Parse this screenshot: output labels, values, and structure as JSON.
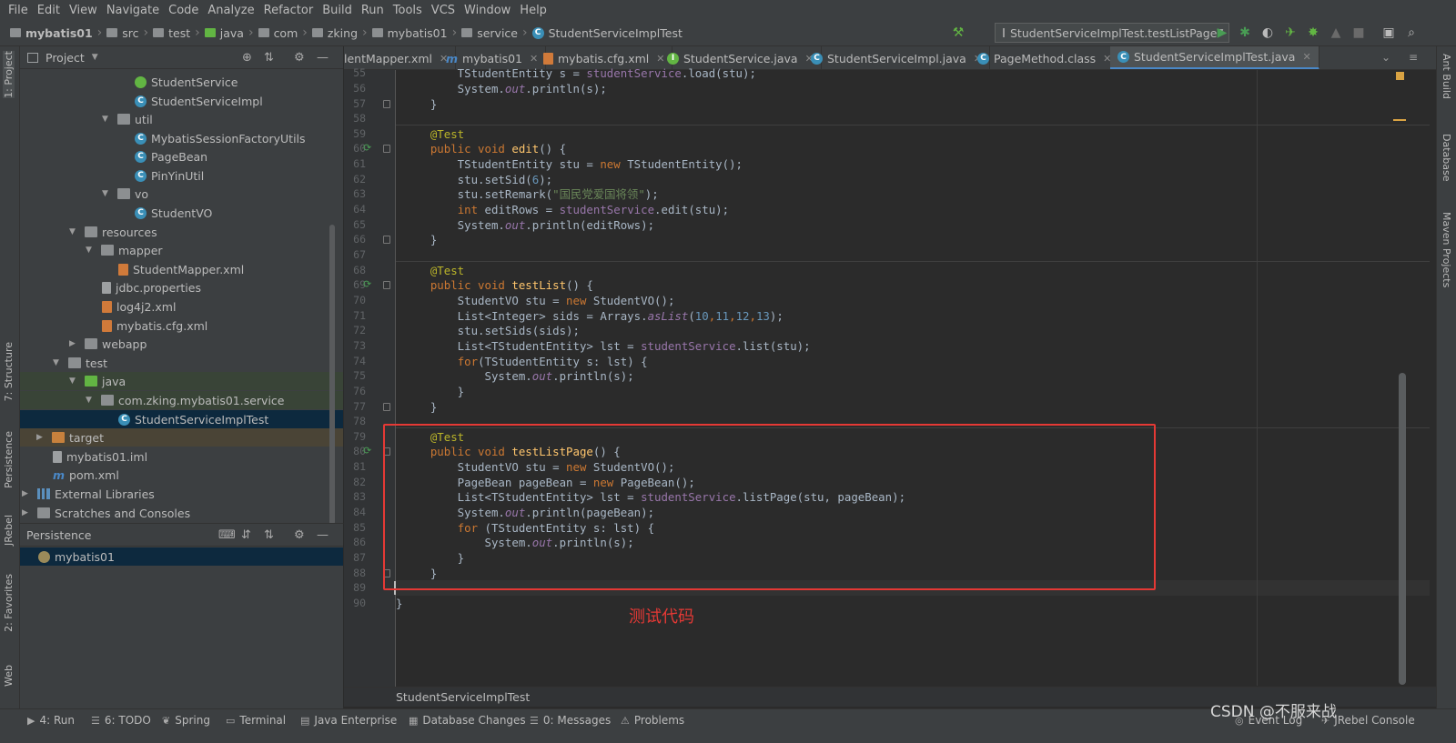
{
  "menu": [
    "File",
    "Edit",
    "View",
    "Navigate",
    "Code",
    "Analyze",
    "Refactor",
    "Build",
    "Run",
    "Tools",
    "VCS",
    "Window",
    "Help"
  ],
  "breadcrumb": [
    "mybatis01",
    "src",
    "test",
    "java",
    "com",
    "zking",
    "mybatis01",
    "service",
    "StudentServiceImplTest"
  ],
  "run_config": "StudentServiceImplTest.testListPage",
  "left_tabs": {
    "project": "1: Project",
    "structure": "7: Structure",
    "persistence": "Persistence",
    "jrebel": "JRebel",
    "favorites": "2: Favorites",
    "web": "Web"
  },
  "right_tabs": {
    "ant": "Ant Build",
    "database": "Database",
    "maven": "Maven Projects"
  },
  "project_panel": {
    "title": "Project",
    "tree": [
      {
        "label": "StudentService",
        "icon": "interface-icon"
      },
      {
        "label": "StudentServiceImpl",
        "icon": "class-icon"
      },
      {
        "label": "util",
        "icon": "package-icon"
      },
      {
        "label": "MybatisSessionFactoryUtils",
        "icon": "class-icon"
      },
      {
        "label": "PageBean",
        "icon": "class-icon"
      },
      {
        "label": "PinYinUtil",
        "icon": "class-icon"
      },
      {
        "label": "vo",
        "icon": "package-icon"
      },
      {
        "label": "StudentVO",
        "icon": "class-icon"
      },
      {
        "label": "resources",
        "icon": "resources-folder-icon"
      },
      {
        "label": "mapper",
        "icon": "folder-icon"
      },
      {
        "label": "StudentMapper.xml",
        "icon": "xml-file-icon"
      },
      {
        "label": "jdbc.properties",
        "icon": "properties-file-icon"
      },
      {
        "label": "log4j2.xml",
        "icon": "xml-file-icon"
      },
      {
        "label": "mybatis.cfg.xml",
        "icon": "xml-file-icon"
      },
      {
        "label": "webapp",
        "icon": "folder-icon"
      },
      {
        "label": "test",
        "icon": "folder-icon"
      },
      {
        "label": "java",
        "icon": "test-source-folder-icon"
      },
      {
        "label": "com.zking.mybatis01.service",
        "icon": "package-icon"
      },
      {
        "label": "StudentServiceImplTest",
        "icon": "test-class-icon"
      },
      {
        "label": "target",
        "icon": "excluded-folder-icon"
      },
      {
        "label": "mybatis01.iml",
        "icon": "iml-file-icon"
      },
      {
        "label": "pom.xml",
        "icon": "maven-icon"
      },
      {
        "label": "External Libraries",
        "icon": "library-icon"
      },
      {
        "label": "Scratches and Consoles",
        "icon": "scratches-icon"
      }
    ]
  },
  "persistence_panel": {
    "title": "Persistence",
    "items": [
      "mybatis01"
    ]
  },
  "editor_tabs": [
    {
      "label": "lentMapper.xml"
    },
    {
      "label": "mybatis01"
    },
    {
      "label": "mybatis.cfg.xml"
    },
    {
      "label": "StudentService.java"
    },
    {
      "label": "StudentServiceImpl.java"
    },
    {
      "label": "PageMethod.class"
    },
    {
      "label": "StudentServiceImplTest.java",
      "active": true
    }
  ],
  "code": {
    "line_numbers": [
      "55",
      "56",
      "57",
      "58",
      "59",
      "60",
      "61",
      "62",
      "63",
      "64",
      "65",
      "66",
      "67",
      "68",
      "69",
      "70",
      "71",
      "72",
      "73",
      "74",
      "75",
      "76",
      "77",
      "78",
      "79",
      "80",
      "81",
      "82",
      "83",
      "84",
      "85",
      "86",
      "87",
      "88",
      "89",
      "90"
    ],
    "lines": [
      [
        "        TStudentEntity s = ",
        "studentService",
        ".load(stu);"
      ],
      [
        "        System.",
        "out",
        ".println(s);"
      ],
      [
        "    }"
      ],
      [
        ""
      ],
      [
        "    @Test"
      ],
      [
        "    public void ",
        "edit",
        "() {"
      ],
      [
        "        TStudentEntity stu = ",
        "new ",
        "TStudentEntity();"
      ],
      [
        "        stu.setSid(",
        "6",
        ");"
      ],
      [
        "        stu.setRemark(",
        "\"国民党爱国将领\"",
        ");"
      ],
      [
        "        ",
        "int ",
        "editRows = ",
        "studentService",
        ".edit(stu);"
      ],
      [
        "        System.",
        "out",
        ".println(editRows);"
      ],
      [
        "    }"
      ],
      [
        ""
      ],
      [
        "    @Test"
      ],
      [
        "    public void ",
        "testList",
        "() {"
      ],
      [
        "        StudentVO stu = ",
        "new ",
        "StudentVO();"
      ],
      [
        "        List<Integer> sids = Arrays.",
        "asList",
        "(",
        "10",
        ",",
        "11",
        ",",
        "12",
        ",",
        "13",
        ");"
      ],
      [
        "        stu.setSids(sids);"
      ],
      [
        "        List<TStudentEntity> lst = ",
        "studentService",
        ".list(stu);"
      ],
      [
        "        ",
        "for",
        "(TStudentEntity s: lst) {"
      ],
      [
        "            System.",
        "out",
        ".println(s);"
      ],
      [
        "        }"
      ],
      [
        "    }"
      ],
      [
        ""
      ],
      [
        "    @Test"
      ],
      [
        "    public void ",
        "testListPage",
        "() {"
      ],
      [
        "        StudentVO stu = ",
        "new ",
        "StudentVO();"
      ],
      [
        "        PageBean pageBean = ",
        "new ",
        "PageBean();"
      ],
      [
        "        List<TStudentEntity> lst = ",
        "studentService",
        ".listPage(stu, pageBean);"
      ],
      [
        "        System.",
        "out",
        ".println(pageBean);"
      ],
      [
        "        ",
        "for ",
        "(TStudentEntity s: lst) {"
      ],
      [
        "            System.",
        "out",
        ".println(s);"
      ],
      [
        "        }"
      ],
      [
        "    }"
      ],
      [
        ""
      ],
      [
        "}"
      ]
    ]
  },
  "annotation": "测试代码",
  "editor_breadcrumb": "StudentServiceImplTest",
  "bottom_tabs": [
    "4: Run",
    "6: TODO",
    "Spring",
    "Terminal",
    "Java Enterprise",
    "Database Changes",
    "0: Messages",
    "Problems",
    "Event Log",
    "JRebel Console"
  ],
  "watermark": "CSDN @不服来战",
  "colors": {
    "keyword": "#cc7832",
    "annotation": "#bbb529",
    "method": "#ffc66d",
    "field": "#9876aa",
    "number": "#6897bb",
    "string": "#6a8759",
    "highlight_box": "#e53935"
  }
}
